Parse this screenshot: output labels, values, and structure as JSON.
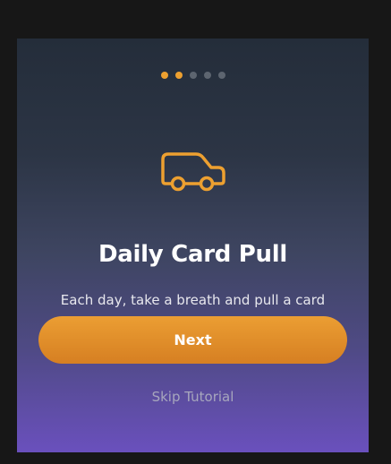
{
  "onboarding": {
    "steps_total": 5,
    "current_step": 2,
    "icon": "car-icon",
    "title": "Daily Card Pull",
    "description": "Each day, take a breath and pull a card",
    "next_label": "Next",
    "skip_label": "Skip Tutorial"
  },
  "colors": {
    "accent": "#eda030",
    "dot_inactive": "#5d6570",
    "background_top": "#242d3a",
    "background_bottom": "#6a50bd"
  }
}
